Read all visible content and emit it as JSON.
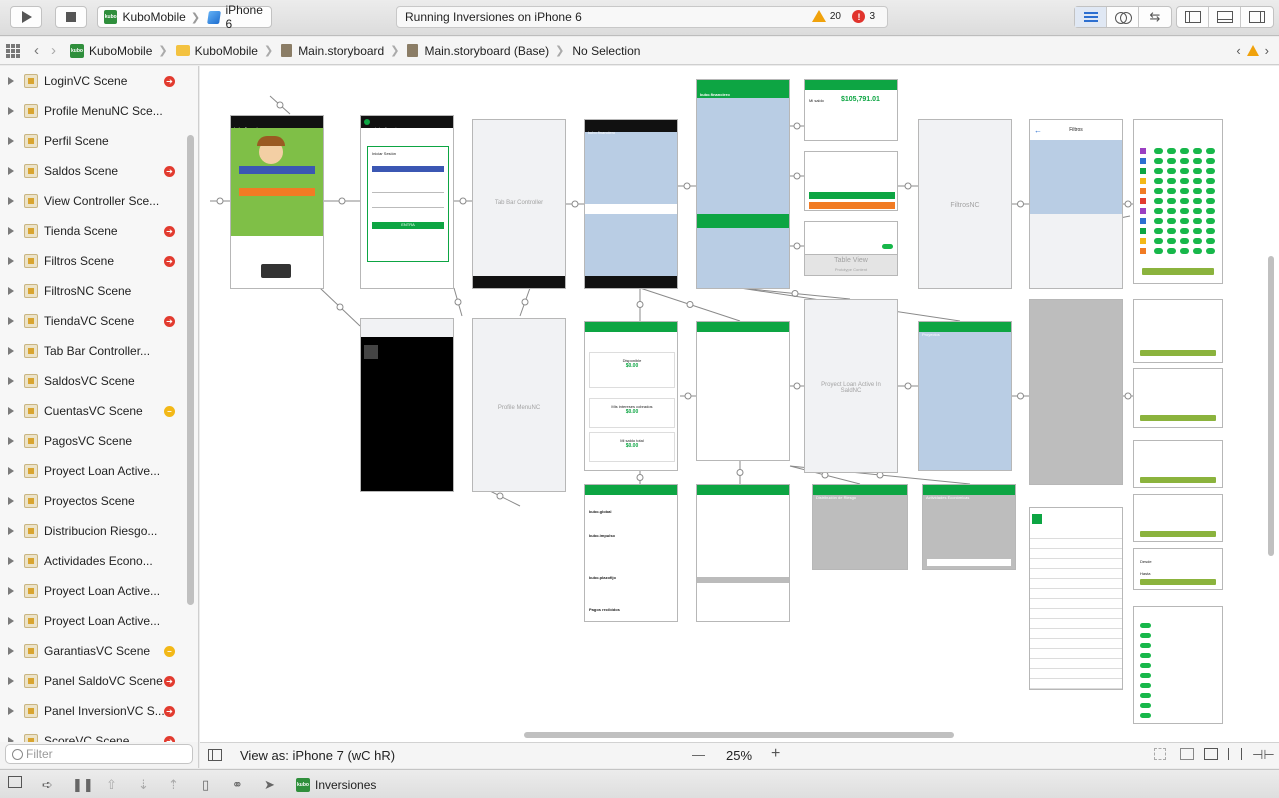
{
  "toolbar": {
    "scheme": "KuboMobile",
    "device": "iPhone 6",
    "status": "Running Inversiones on iPhone 6",
    "warnings": "20",
    "errors": "3",
    "app_badge": "kubo"
  },
  "jumpbar": {
    "crumbs": [
      "KuboMobile",
      "KuboMobile",
      "Main.storyboard",
      "Main.storyboard (Base)",
      "No Selection"
    ]
  },
  "navigator": {
    "scenes": [
      {
        "label": "LoginVC Scene",
        "badge": "red"
      },
      {
        "label": "Profile MenuNC Sce...",
        "badge": "none"
      },
      {
        "label": "Perfil Scene",
        "badge": "none"
      },
      {
        "label": "Saldos Scene",
        "badge": "red"
      },
      {
        "label": "View Controller Sce...",
        "badge": "none"
      },
      {
        "label": "Tienda Scene",
        "badge": "red"
      },
      {
        "label": "Filtros Scene",
        "badge": "red"
      },
      {
        "label": "FiltrosNC Scene",
        "badge": "none"
      },
      {
        "label": "TiendaVC Scene",
        "badge": "red"
      },
      {
        "label": "Tab Bar Controller...",
        "badge": "none"
      },
      {
        "label": "SaldosVC Scene",
        "badge": "none"
      },
      {
        "label": "CuentasVC Scene",
        "badge": "yellow"
      },
      {
        "label": "PagosVC Scene",
        "badge": "none"
      },
      {
        "label": "Proyect Loan Active...",
        "badge": "none"
      },
      {
        "label": "Proyectos Scene",
        "badge": "none"
      },
      {
        "label": "Distribucion Riesgo...",
        "badge": "none"
      },
      {
        "label": "Actividades Econo...",
        "badge": "none"
      },
      {
        "label": "Proyect Loan Active...",
        "badge": "none"
      },
      {
        "label": "Proyect Loan Active...",
        "badge": "none"
      },
      {
        "label": "GarantiasVC Scene",
        "badge": "yellow"
      },
      {
        "label": "Panel SaldoVC Scene",
        "badge": "red"
      },
      {
        "label": "Panel InversionVC S...",
        "badge": "red"
      },
      {
        "label": "ScoreVC Scene",
        "badge": "red"
      }
    ],
    "filter_placeholder": "Filter"
  },
  "canvas": {
    "texts": {
      "tab_bar_controller": "Tab Bar Controller",
      "profile_menunc": "Profile MenuNC",
      "filtrosnc": "FiltrosNC",
      "proyect_loan": "Proyect Loan Active In SaldNC",
      "table_view": "Table View",
      "table_view_sub": "Prototype Content",
      "kubo_brand": "kubo.financiero",
      "iniciar_sesion": "Iniciar Sesión",
      "entrar": "ENTRA",
      "resumen_saldos": "Resumen de Saldos",
      "disponible": "Disponible",
      "disponible_val": "$0.00",
      "intereses_cobrados": "Mis intereses cobrados",
      "intereses_val": "$0.00",
      "saldo_total": "Mi saldo total",
      "saldo_total_val": "$0.00",
      "mi_saldo_amount": "$105,791.01",
      "mi_saldo_label": "Mi saldo",
      "resumen": "Resumen",
      "resumen_pagos": "Resumen de pagos",
      "resumen_inv": "Resumen de tus inversiones",
      "distribucion": "Distribución de Riesgo",
      "actividades": "Actividades Económicas",
      "filtros": "Filtros",
      "proyectos": "Proyectos",
      "aplicar": "Buscar",
      "saldo_total_row": "Saldo total",
      "pagos_recibidos": "Pagos recibidos",
      "kubo_global": "kubo.global",
      "kubo_impulso": "kubo.impulso",
      "kubo_plazofijo": "kubo.plazofijo",
      "calificacion": "Calificación de los proyectos",
      "desde": "Desde",
      "hasta": "Hasta"
    }
  },
  "canvas_bottom": {
    "view_as": "View as: iPhone 7 (wC hR)",
    "zoom": "25%",
    "zoom_minus": "—",
    "zoom_plus": "+"
  },
  "debugbar": {
    "target": "Inversiones"
  },
  "colors": {
    "green": "#0da543",
    "blue_body": "#b9cde4",
    "red_badge": "#e23b2f",
    "yellow_badge": "#f3b817"
  }
}
